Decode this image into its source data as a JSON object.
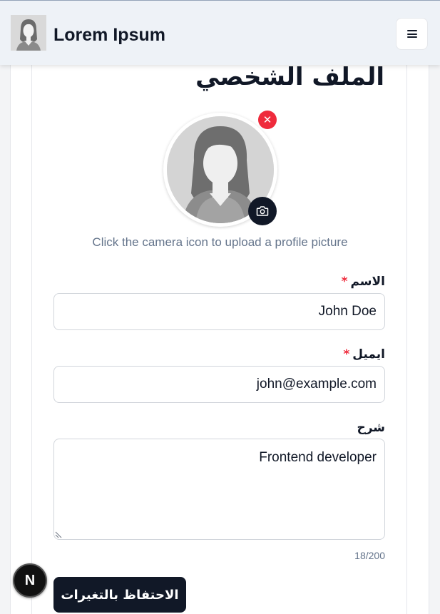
{
  "header": {
    "app_title": "Lorem Ipsum",
    "menu_icon": "hamburger-icon"
  },
  "profile": {
    "heading": "الملف الشخصي",
    "remove_icon": "close-icon",
    "remove_glyph": "✕",
    "camera_icon": "camera-icon",
    "upload_hint": "Click the camera icon to upload a profile picture"
  },
  "form": {
    "name_label": "الاسم",
    "name_value": "John Doe",
    "email_label": "ايميل",
    "email_value": "john@example.com",
    "required_mark": "*",
    "bio_label": "شرح",
    "bio_value": "Frontend developer",
    "char_count": "18/200",
    "save_label": "الاحتفاظ بالتغيرات"
  },
  "dev_badge": {
    "letter": "N"
  },
  "colors": {
    "accent_dark": "#111827",
    "danger": "#ef2b3c",
    "muted_text": "#64748b"
  }
}
